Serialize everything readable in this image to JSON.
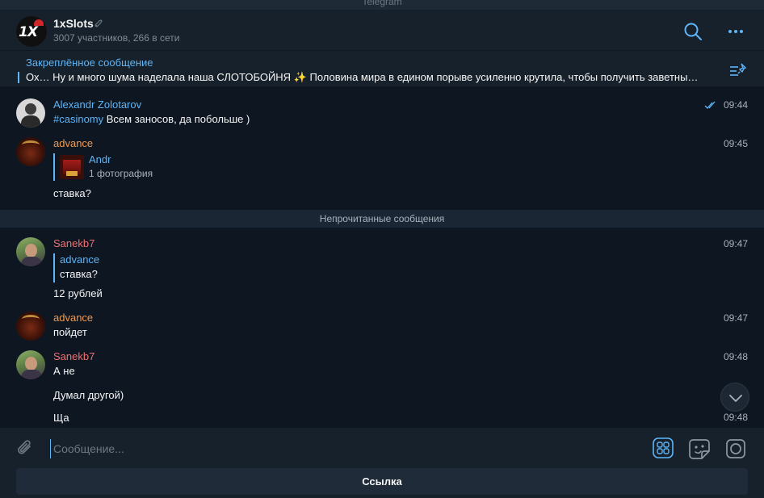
{
  "window": {
    "title": "Telegram"
  },
  "chat": {
    "name": "1xSlots",
    "subtitle": "3007 участников, 266 в сети",
    "avatar_logo": "1X"
  },
  "pinned": {
    "label": "Закреплённое сообщение",
    "text": "Ох… Ну и много шума наделала наша СЛОТОБОЙНЯ ✨  Половина мира в едином порыве усиленно крутила, чтобы получить заветны…"
  },
  "messages": [
    {
      "sender": "Alexandr Zolotarov",
      "hashtag": "#casinomy",
      "text": " Всем заносов, да побольше )",
      "time": "09:44",
      "read": true
    },
    {
      "sender": "advance",
      "reply": {
        "name": "Andr",
        "text": "1 фотография"
      },
      "text": "ставка?",
      "time": "09:45"
    },
    {
      "sender": "Sanekb7",
      "reply": {
        "name": "advance",
        "text": "ставка?"
      },
      "text": "12 рублей",
      "time": "09:47"
    },
    {
      "sender": "advance",
      "text": "пойдет",
      "time": "09:47"
    },
    {
      "sender": "Sanekb7",
      "text": "А не",
      "time": "09:48"
    },
    {
      "sender": "",
      "text": "Думал другой)",
      "time": ""
    },
    {
      "sender": "",
      "text": "Ща",
      "time": "09:48"
    }
  ],
  "unread_divider": "Непрочитанные сообщения",
  "composer": {
    "placeholder": "Сообщение...",
    "link_button": "Ссылка"
  },
  "colors": {
    "accent": "#5eb5f7",
    "sender_orange": "#f09a4f",
    "sender_red": "#ef7072",
    "background": "#0e1621",
    "panel": "#17212b"
  },
  "icons": [
    "mute-icon",
    "search-icon",
    "more-icon",
    "pin-list-icon",
    "read-check-icon",
    "chevron-down-icon",
    "attach-icon",
    "commands-icon",
    "sticker-icon",
    "camera-icon"
  ]
}
